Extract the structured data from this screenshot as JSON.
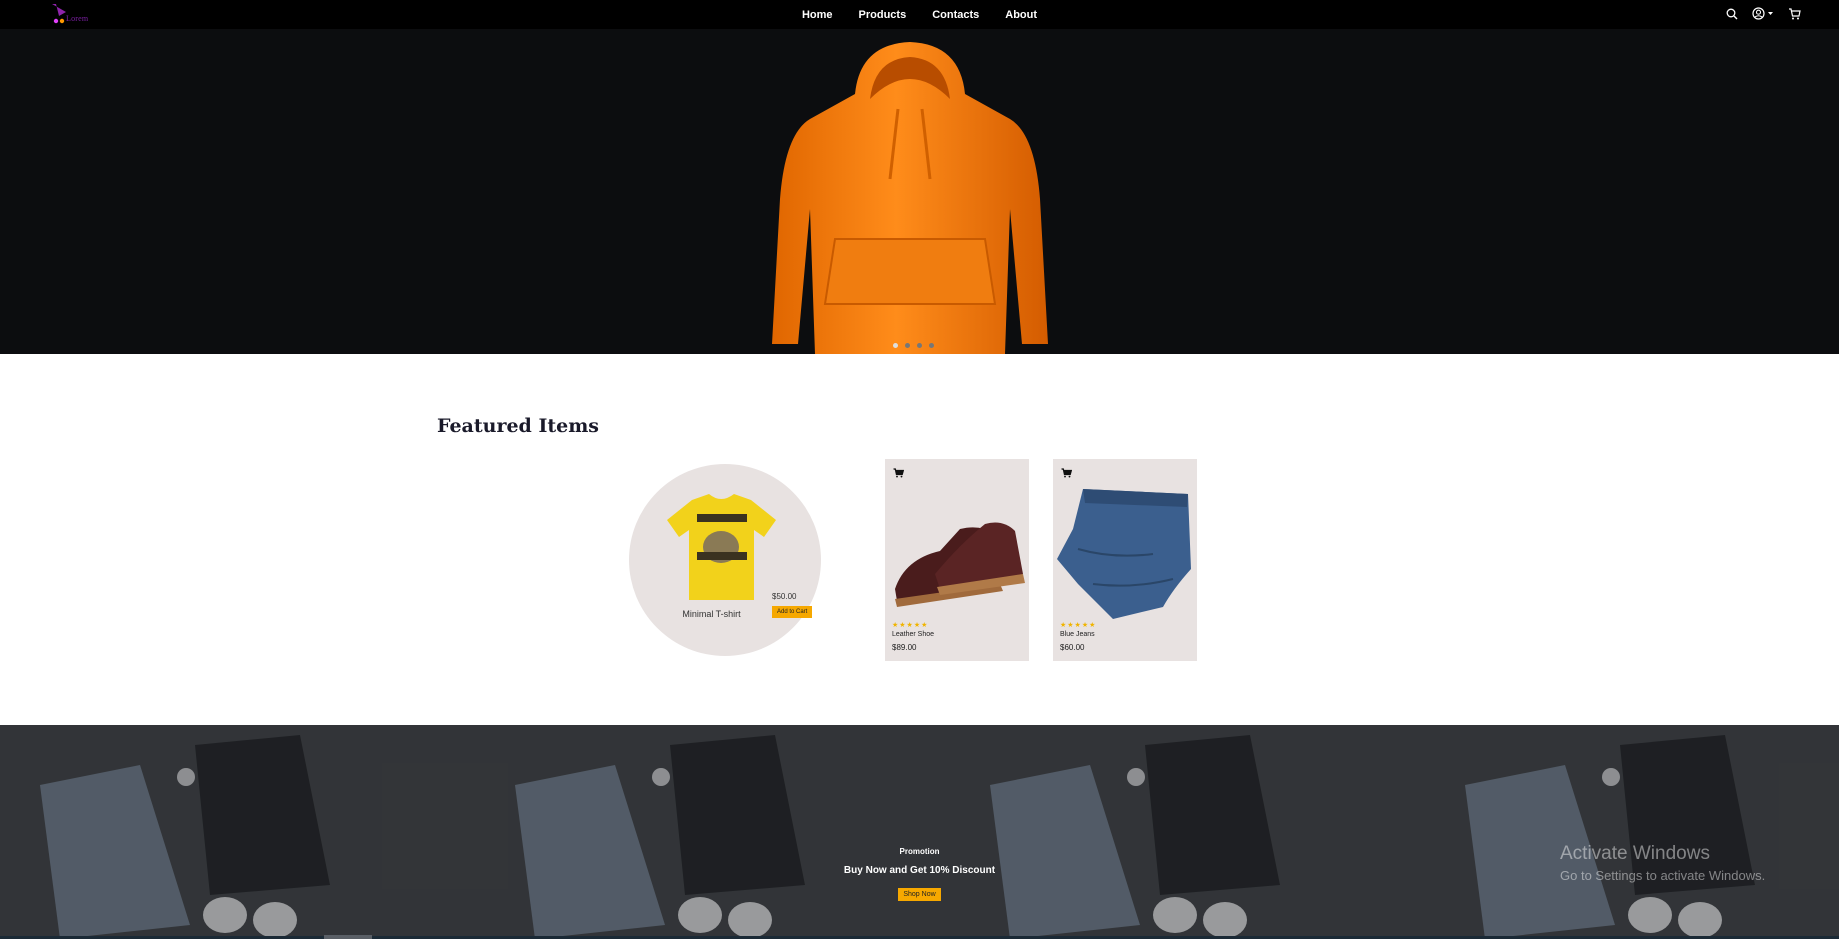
{
  "brand": {
    "logo_text": "Lorem",
    "accent": "#7b1fa2"
  },
  "nav": {
    "links": [
      "Home",
      "Products",
      "Contacts",
      "About"
    ],
    "icons": [
      "search-icon",
      "user-icon",
      "chevron-down-icon",
      "cart-icon"
    ]
  },
  "hero": {
    "image": "orange-hoodie",
    "slides_count": 4,
    "active_slide": 1
  },
  "featured": {
    "title": "Featured Items",
    "highlight": {
      "name": "Minimal T-shirt",
      "price": "$50.00",
      "button": "Add to Cart"
    },
    "cards": [
      {
        "name": "Leather Shoe",
        "price": "$89.00",
        "stars": "★★★★★",
        "rating": 5
      },
      {
        "name": "Blue Jeans",
        "price": "$60.00",
        "stars": "★★★★★",
        "rating": 5
      }
    ]
  },
  "promo": {
    "label": "Promotion",
    "headline": "Buy Now and Get 10% Discount",
    "button": "Shop Now"
  },
  "watermark": {
    "line1": "Activate Windows",
    "line2": "Go to Settings to activate Windows."
  },
  "colors": {
    "button": "#f6a800",
    "nav_bg": "#000000",
    "hero_bg": "#0c0d0f",
    "card_bg": "#e8e2e1"
  }
}
